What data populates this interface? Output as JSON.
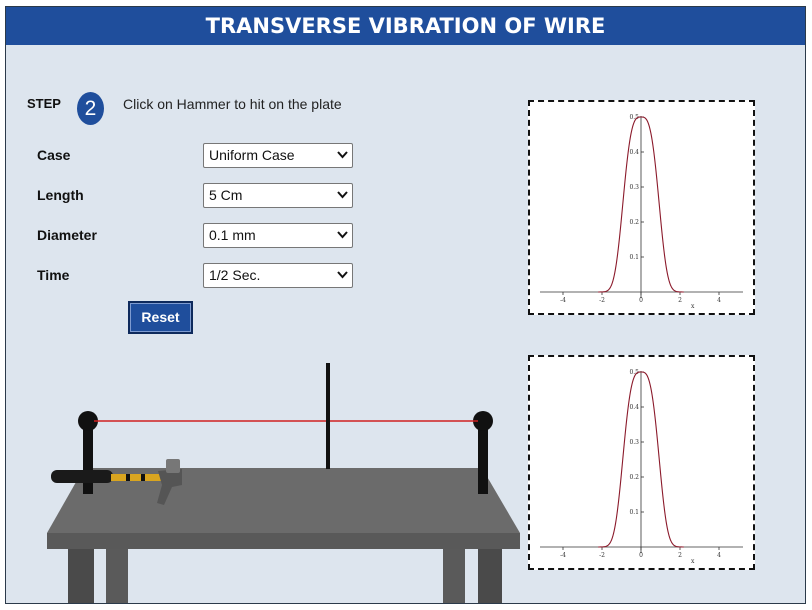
{
  "title": "TRANSVERSE VIBRATION OF WIRE",
  "step": {
    "label": "STEP",
    "number": "2",
    "instruction": "Click on Hammer to hit on the plate"
  },
  "controls": [
    {
      "label": "Case",
      "value": "Uniform Case"
    },
    {
      "label": "Length",
      "value": "5 Cm"
    },
    {
      "label": "Diameter",
      "value": "0.1 mm"
    },
    {
      "label": "Time",
      "value": "1/2 Sec."
    }
  ],
  "reset_label": "Reset",
  "colors": {
    "header": "#1f4e9c",
    "wire": "#d02020",
    "curve": "#8b1a2b",
    "panel": "#dde5ee"
  },
  "graph_axis": {
    "x_label": "x",
    "x_ticks": [
      "-4",
      "-2",
      "0",
      "2",
      "4"
    ],
    "y_ticks": [
      "0.1",
      "0.2",
      "0.3",
      "0.4",
      "0.5"
    ]
  }
}
